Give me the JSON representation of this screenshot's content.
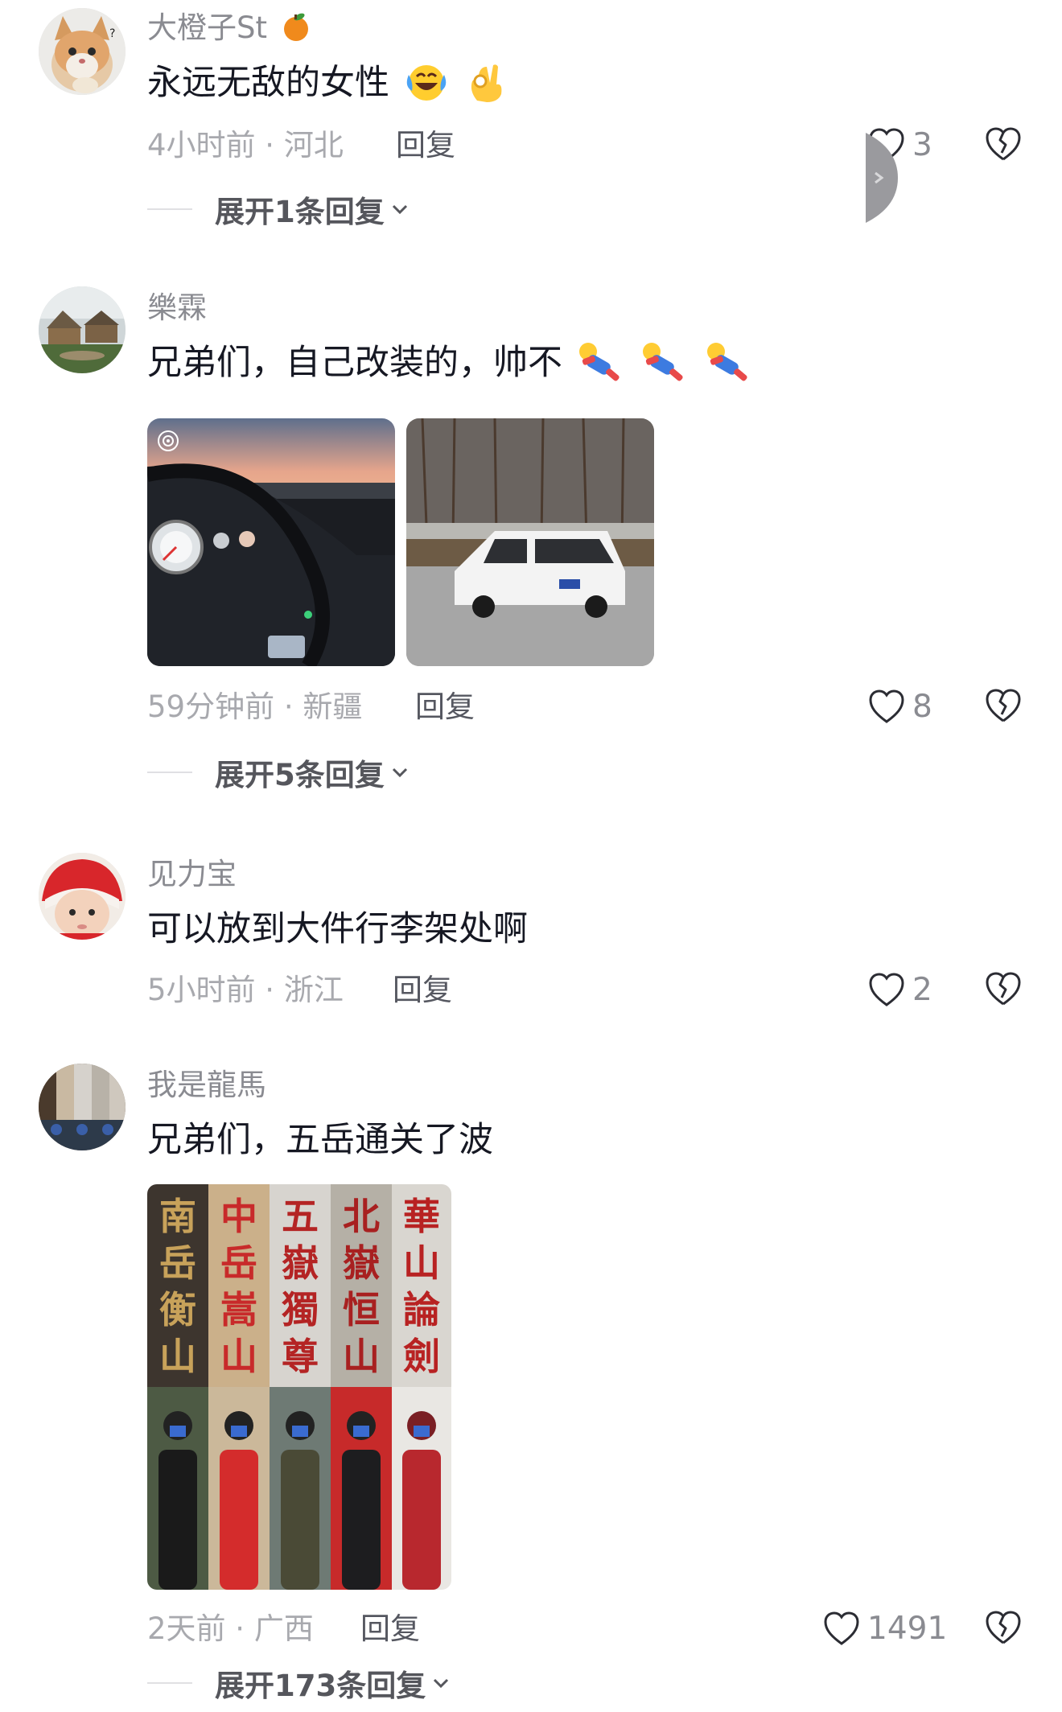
{
  "comments": [
    {
      "username": "大橙子St",
      "text": "永远无敌的女性",
      "time": "4小时前 · 河北",
      "reply_label": "回复",
      "likes": "3",
      "expand": "展开1条回复"
    },
    {
      "username": "樂霖",
      "text": "兄弟们，自己改装的，帅不",
      "time": "59分钟前 · 新疆",
      "reply_label": "回复",
      "likes": "8",
      "expand": "展开5条回复"
    },
    {
      "username": "见力宝",
      "text": "可以放到大件行李架处啊",
      "time": "5小时前 · 浙江",
      "reply_label": "回复",
      "likes": "2"
    },
    {
      "username": "我是龍馬",
      "text": "兄弟们，五岳通关了波",
      "time": "2天前 · 广西",
      "reply_label": "回复",
      "likes": "1491",
      "expand": "展开173条回复",
      "image_text": [
        "南岳衡山",
        "中岳嵩山",
        "五嶽獨尊",
        "北嶽恒山",
        "華山論劍"
      ]
    }
  ],
  "icons": {
    "like": "heart-outline-icon",
    "dislike": "broken-heart-icon",
    "expand": "chevron-down-icon",
    "side_tab": "chevron-right-icon"
  },
  "colors": {
    "text": "#161823",
    "username": "#8a8b91",
    "meta": "#a8a9ae"
  }
}
